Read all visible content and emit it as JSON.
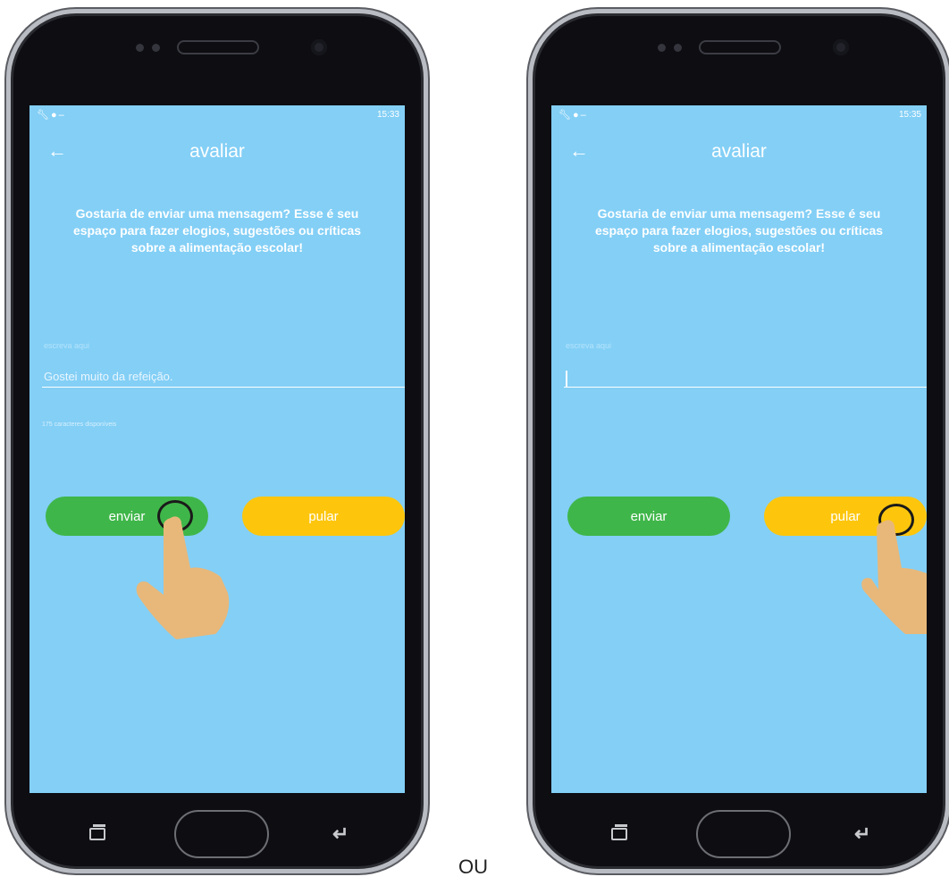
{
  "ou_text": "OU",
  "colors": {
    "screen_bg": "#83cff6",
    "send_button": "#3fb649",
    "skip_button": "#fdc60d",
    "hand": "#e8b87a"
  },
  "phones": [
    {
      "status_time": "15:33",
      "back_icon": "arrow-left-icon",
      "title": "avaliar",
      "prompt": "Gostaria de enviar uma mensagem? Esse é seu espaço para fazer elogios, sugestões ou críticas sobre a alimentação escolar!",
      "field_label": "escreva aqui",
      "field_value": "Gostei muito da refeição.",
      "char_counter": "175 caracteres disponíveis",
      "send_label": "enviar",
      "skip_label": "pular",
      "tapped": "enviar"
    },
    {
      "status_time": "15:35",
      "back_icon": "arrow-left-icon",
      "title": "avaliar",
      "prompt": "Gostaria de enviar uma mensagem? Esse é seu espaço para fazer elogios, sugestões ou críticas sobre a alimentação escolar!",
      "field_label": "escreva aqui",
      "field_value": "",
      "send_label": "enviar",
      "skip_label": "pular",
      "tapped": "pular"
    }
  ]
}
